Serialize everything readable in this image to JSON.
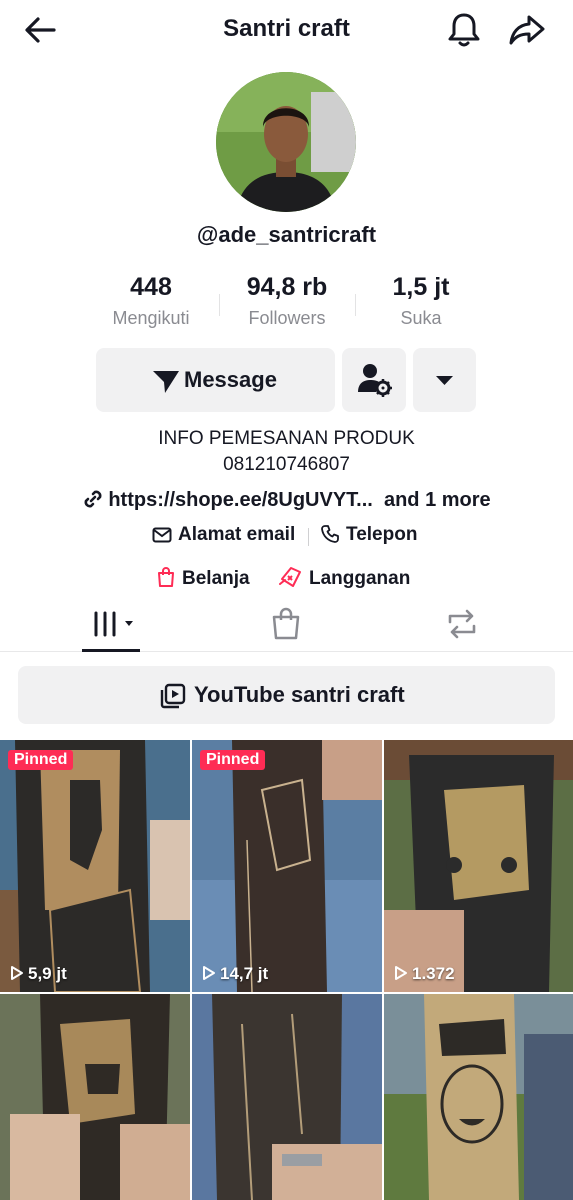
{
  "header": {
    "title": "Santri craft",
    "back_icon": "arrow-left-icon",
    "bell_icon": "bell-icon",
    "share_icon": "share-arrow-icon"
  },
  "profile": {
    "username": "@ade_santricraft",
    "stats": [
      {
        "value": "448",
        "label": "Mengikuti"
      },
      {
        "value": "94,8 rb",
        "label": "Followers"
      },
      {
        "value": "1,5 jt",
        "label": "Suka"
      }
    ],
    "message_label": "Message",
    "bio_line1": "INFO PEMESANAN PRODUK",
    "bio_line2": "081210746807",
    "link_text": "https://shope.ee/8UgUVYT...",
    "link_more": "and 1 more",
    "email_label": "Alamat email",
    "phone_label": "Telepon",
    "shop_label": "Belanja",
    "subscribe_label": "Langganan"
  },
  "youtube_button": "YouTube santri craft",
  "videos": [
    {
      "views": "5,9 jt",
      "pinned": "Pinned"
    },
    {
      "views": "14,7 jt",
      "pinned": "Pinned"
    },
    {
      "views": "1.372"
    }
  ],
  "colors": {
    "accent": "#fe2c55",
    "button_bg": "#f1f1f2",
    "text": "#161823",
    "muted": "#8a8b91"
  }
}
